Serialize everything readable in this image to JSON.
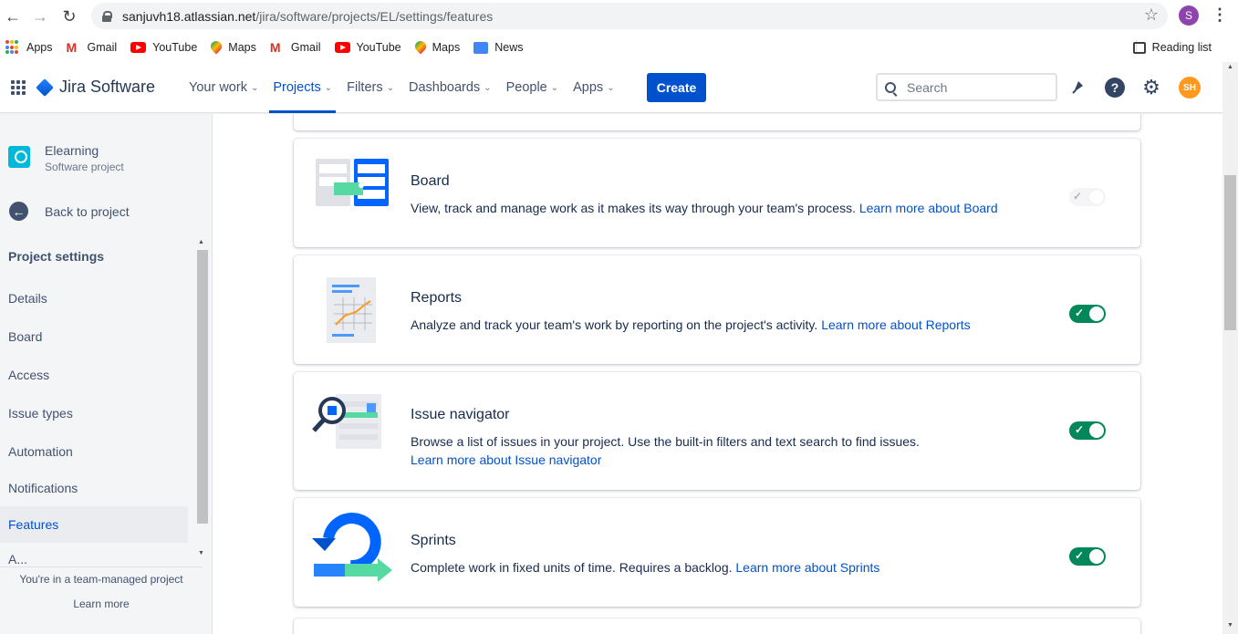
{
  "browser": {
    "url_host": "sanjuvh18.atlassian.net",
    "url_path": "/jira/software/projects/EL/settings/features",
    "profile_initial": "S",
    "bookmarks": [
      "Apps",
      "Gmail",
      "YouTube",
      "Maps",
      "Gmail",
      "YouTube",
      "Maps",
      "News"
    ],
    "reading_list": "Reading list"
  },
  "header": {
    "product": "Jira Software",
    "nav": [
      "Your work",
      "Projects",
      "Filters",
      "Dashboards",
      "People",
      "Apps"
    ],
    "active_nav": "Projects",
    "create_label": "Create",
    "search_placeholder": "Search",
    "avatar_initials": "SH"
  },
  "sidebar": {
    "project_name": "Elearning",
    "project_type": "Software project",
    "back_label": "Back to project",
    "heading": "Project settings",
    "items": [
      "Details",
      "Board",
      "Access",
      "Issue types",
      "Automation",
      "Notifications",
      "Features",
      "A..."
    ],
    "active_item": "Features",
    "footer_text": "You're in a team-managed project",
    "footer_link": "Learn more"
  },
  "features": [
    {
      "title": "Board",
      "desc": "View, track and manage work as it makes its way through your team's process. ",
      "link": "Learn more about Board",
      "enabled": false
    },
    {
      "title": "Reports",
      "desc": "Analyze and track your team's work by reporting on the project's activity. ",
      "link": "Learn more about Reports",
      "enabled": true
    },
    {
      "title": "Issue navigator",
      "desc": "Browse a list of issues in your project. Use the built-in filters and text search to find issues.",
      "link": "Learn more about Issue navigator",
      "enabled": true
    },
    {
      "title": "Sprints",
      "desc": "Complete work in fixed units of time. Requires a backlog. ",
      "link": "Learn more about Sprints",
      "enabled": true
    }
  ],
  "colors": {
    "brand_blue": "#0052cc",
    "toggle_on": "#00875a",
    "avatar": "#ff991f"
  }
}
